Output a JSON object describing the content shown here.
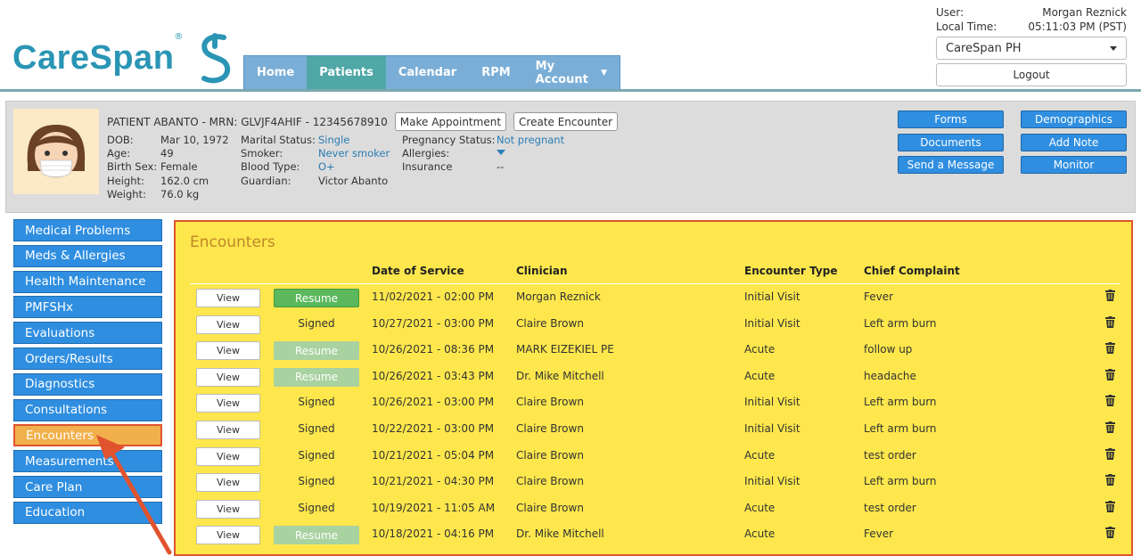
{
  "brand": {
    "name": "CareSpan",
    "reg": "®"
  },
  "nav": {
    "items": [
      {
        "label": "Home",
        "active": false
      },
      {
        "label": "Patients",
        "active": true
      },
      {
        "label": "Calendar",
        "active": false
      },
      {
        "label": "RPM",
        "active": false
      },
      {
        "label": "My Account",
        "active": false
      }
    ]
  },
  "user": {
    "user_label": "User:",
    "user_value": "Morgan Reznick",
    "time_label": "Local Time:",
    "time_value": "05:11:03 PM (PST)",
    "org_select": "CareSpan PH",
    "logout": "Logout"
  },
  "patient": {
    "header": "PATIENT ABANTO - MRN: GLVJF4AHIF - 12345678910",
    "make_appointment": "Make Appointment",
    "create_encounter": "Create Encounter",
    "col1": [
      {
        "label": "DOB:",
        "value": "Mar 10, 1972"
      },
      {
        "label": "Age:",
        "value": "49"
      },
      {
        "label": "Birth Sex:",
        "value": "Female"
      },
      {
        "label": "Height:",
        "value": "162.0 cm"
      },
      {
        "label": "Weight:",
        "value": "76.0 kg"
      }
    ],
    "col2": [
      {
        "label": "Marital Status:",
        "value": "Single"
      },
      {
        "label": "Smoker:",
        "value": "Never smoker"
      },
      {
        "label": "Blood Type:",
        "value": "O+"
      },
      {
        "label": "Guardian:",
        "value": "Victor Abanto"
      }
    ],
    "col3": [
      {
        "label": "Pregnancy Status:",
        "value": "Not pregnant"
      },
      {
        "label": "Allergies:",
        "value": ""
      },
      {
        "label": "Insurance",
        "value": "--"
      }
    ],
    "actions": {
      "forms": "Forms",
      "demographics": "Demographics",
      "documents": "Documents",
      "add_note": "Add Note",
      "send_message": "Send a Message",
      "monitor": "Monitor"
    }
  },
  "sidebar": {
    "items": [
      {
        "label": "Medical Problems"
      },
      {
        "label": "Meds & Allergies"
      },
      {
        "label": "Health Maintenance"
      },
      {
        "label": "PMFSHx"
      },
      {
        "label": "Evaluations"
      },
      {
        "label": "Orders/Results"
      },
      {
        "label": "Diagnostics"
      },
      {
        "label": "Consultations"
      },
      {
        "label": "Encounters",
        "active": true
      },
      {
        "label": "Measurements"
      },
      {
        "label": "Care Plan"
      },
      {
        "label": "Education"
      }
    ]
  },
  "encounters": {
    "title": "Encounters",
    "headers": {
      "date": "Date of Service",
      "clinician": "Clinician",
      "type": "Encounter Type",
      "complaint": "Chief Complaint"
    },
    "view_label": "View",
    "resume_label": "Resume",
    "signed_label": "Signed",
    "rows": [
      {
        "status": "resume-active",
        "date": "11/02/2021 - 02:00 PM",
        "clinician": "Morgan Reznick",
        "type": "Initial Visit",
        "complaint": "Fever"
      },
      {
        "status": "signed",
        "date": "10/27/2021 - 03:00 PM",
        "clinician": "Claire Brown",
        "type": "Initial Visit",
        "complaint": "Left arm burn"
      },
      {
        "status": "resume-faded",
        "date": "10/26/2021 - 08:36 PM",
        "clinician": "MARK EIZEKIEL PE",
        "type": "Acute",
        "complaint": "follow up"
      },
      {
        "status": "resume-faded",
        "date": "10/26/2021 - 03:43 PM",
        "clinician": "Dr. Mike Mitchell",
        "type": "Acute",
        "complaint": "headache"
      },
      {
        "status": "signed",
        "date": "10/26/2021 - 03:00 PM",
        "clinician": "Claire Brown",
        "type": "Initial Visit",
        "complaint": "Left arm burn"
      },
      {
        "status": "signed",
        "date": "10/22/2021 - 03:00 PM",
        "clinician": "Claire Brown",
        "type": "Initial Visit",
        "complaint": "Left arm burn"
      },
      {
        "status": "signed",
        "date": "10/21/2021 - 05:04 PM",
        "clinician": "Claire Brown",
        "type": "Acute",
        "complaint": "test order"
      },
      {
        "status": "signed",
        "date": "10/21/2021 - 04:30 PM",
        "clinician": "Claire Brown",
        "type": "Initial Visit",
        "complaint": "Left arm burn"
      },
      {
        "status": "signed",
        "date": "10/19/2021 - 11:05 AM",
        "clinician": "Claire Brown",
        "type": "Acute",
        "complaint": "test order"
      },
      {
        "status": "resume-faded",
        "date": "10/18/2021 - 04:16 PM",
        "clinician": "Dr. Mike Mitchell",
        "type": "Acute",
        "complaint": "Fever"
      }
    ]
  },
  "colors": {
    "primary": "#2f8ee0",
    "teal": "#4fa7a6",
    "highlight": "#fde74c",
    "annotation": "#e0532e",
    "resume": "#5cb85c"
  },
  "icons": {
    "trash": "trash-icon",
    "caret": "chevron-down-icon",
    "arrow": "annotation-arrow"
  }
}
